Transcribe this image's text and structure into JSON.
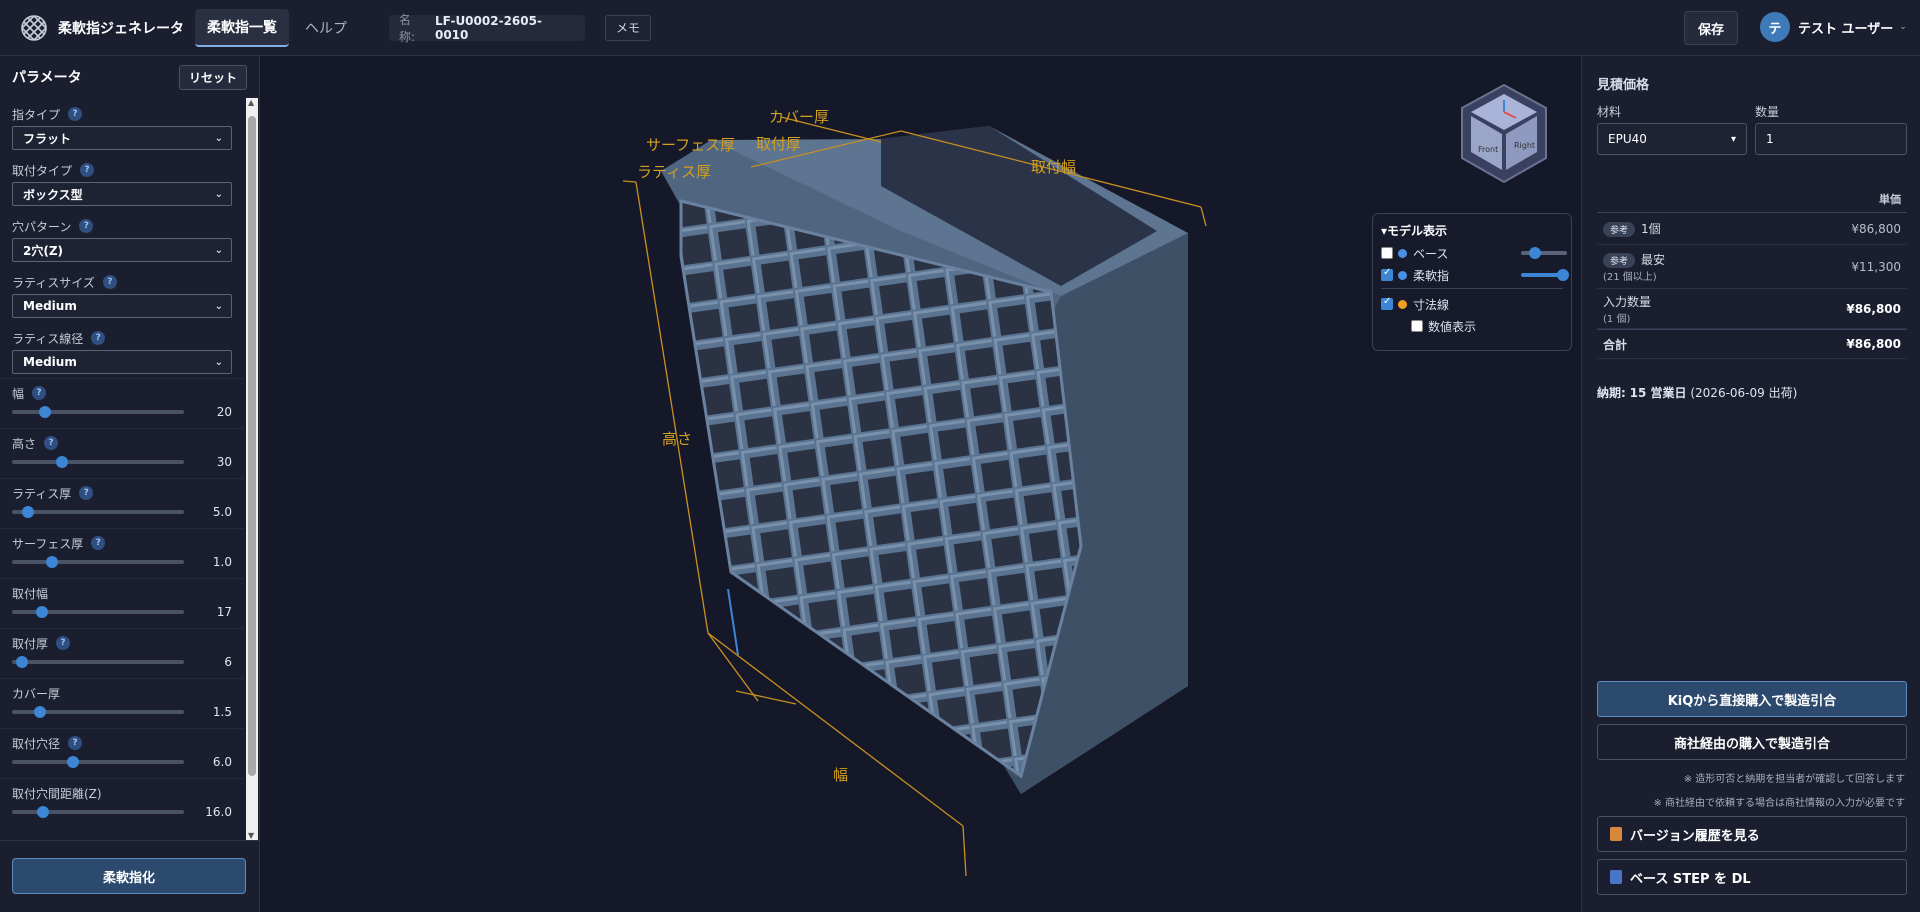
{
  "header": {
    "app_title": "柔軟指ジェネレータ",
    "tabs": [
      {
        "label": "柔軟指一覧"
      },
      {
        "label": "ヘルプ"
      }
    ],
    "name_label": "名称:",
    "name_value": "LF-U0002-2605-0010",
    "memo_label": "メモ",
    "save_label": "保存",
    "user_initial": "テ",
    "user_name": "テスト ユーザー",
    "user_caret": "⌄"
  },
  "params": {
    "title": "パラメータ",
    "reset_label": "リセット",
    "selects": [
      {
        "label": "指タイプ",
        "value": "フラット",
        "help": "?"
      },
      {
        "label": "取付タイプ",
        "value": "ボックス型",
        "help": "?"
      },
      {
        "label": "穴パターン",
        "value": "2穴(Z)",
        "help": "?"
      },
      {
        "label": "ラティスサイズ",
        "value": "Medium",
        "help": "?"
      },
      {
        "label": "ラティス線径",
        "value": "Medium",
        "help": "?"
      }
    ],
    "sliders": [
      {
        "label": "幅",
        "value": "20",
        "help": "?",
        "position": 0.19
      },
      {
        "label": "高さ",
        "value": "30",
        "help": "?",
        "position": 0.29
      },
      {
        "label": "ラティス厚",
        "value": "5.0",
        "help": "?",
        "position": 0.09
      },
      {
        "label": "サーフェス厚",
        "value": "1.0",
        "help": "?",
        "position": 0.23
      },
      {
        "label": "取付幅",
        "value": "17",
        "help": "",
        "position": 0.17
      },
      {
        "label": "取付厚",
        "value": "6",
        "help": "?",
        "position": 0.06
      },
      {
        "label": "カバー厚",
        "value": "1.5",
        "help": "",
        "position": 0.16
      },
      {
        "label": "取付穴径",
        "value": "6.0",
        "help": "?",
        "position": 0.35
      },
      {
        "label": "取付穴間距離(Z)",
        "value": "16.0",
        "help": "",
        "position": 0.18
      }
    ],
    "submit_label": "柔軟指化"
  },
  "viewport": {
    "dimension_labels": {
      "cover": "カバー厚",
      "surface": "サーフェス厚",
      "mount_thickness": "取付厚",
      "lattice": "ラティス厚",
      "mount_width": "取付幅",
      "height": "高さ",
      "width": "幅"
    },
    "cube_faces": {
      "front": "Front",
      "right": "Right"
    },
    "model_panel": {
      "title": "▾モデル表示",
      "rows": [
        {
          "label": "ベース",
          "checked": false,
          "color": "#4a90e2",
          "opacity": 0.3
        },
        {
          "label": "柔軟指",
          "checked": true,
          "color": "#4a90e2",
          "opacity": 1.0
        },
        {
          "label": "寸法線",
          "checked": true,
          "color": "#f0a020"
        },
        {
          "label": "数値表示",
          "checked": false
        }
      ]
    }
  },
  "quote": {
    "title": "見積価格",
    "material_label": "材料",
    "material_value": "EPU40",
    "qty_label": "数量",
    "qty_value": "1",
    "unit_price_header": "単価",
    "rows": [
      {
        "tag": "参考",
        "label": "1個",
        "sub": "",
        "price": "¥86,800"
      },
      {
        "tag": "参考",
        "label": "最安",
        "sub": "(21 個以上)",
        "price": "¥11,300"
      },
      {
        "tag": "",
        "label": "入力数量",
        "sub": "(1 個)",
        "price": "¥86,800"
      },
      {
        "tag": "",
        "label": "合計",
        "sub": "",
        "price": "¥86,800"
      }
    ],
    "delivery_prefix": "納期:",
    "delivery_days": "15 営業日",
    "delivery_date": "(2026-06-09 出荷)",
    "btn_direct": "KiQから直接購入で製造引合",
    "btn_trader": "商社経由の購入で製造引合",
    "note1": "※ 造形可否と納期を担当者が確認して回答します",
    "note2": "※ 商社経由で依頼する場合は商社情報の入力が必要です",
    "link_history": "バージョン履歴を見る",
    "link_step": "ベース STEP を DL"
  },
  "colors": {
    "accent": "#3d86d6",
    "dimension": "#d4a020",
    "model": "#5a7390"
  }
}
